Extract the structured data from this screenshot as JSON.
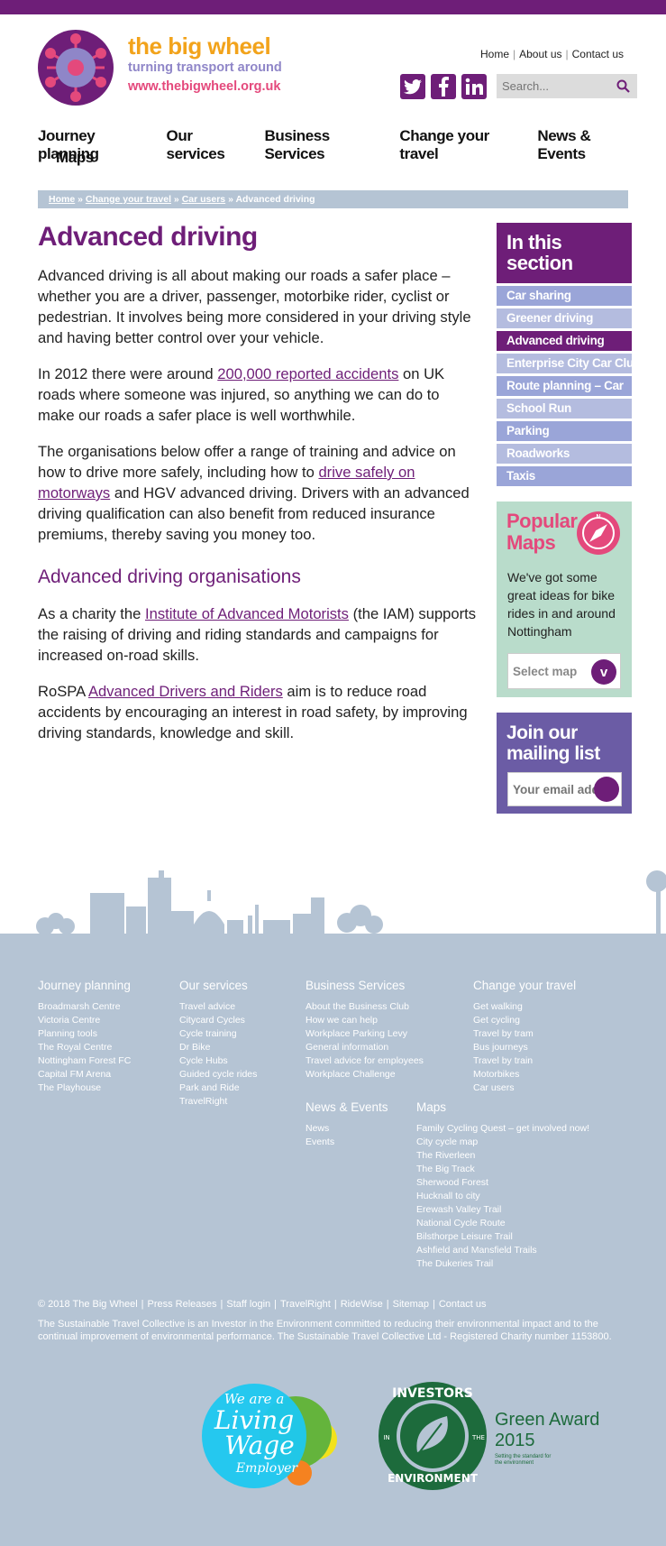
{
  "brand": {
    "name": "the big wheel",
    "tagline": "turning transport around",
    "url": "www.thebigwheel.org.uk",
    "colors": {
      "purple": "#6e1e78",
      "orange": "#f2a31b",
      "lavender": "#8f86c8",
      "pink": "#e4497c"
    }
  },
  "toplinks": [
    "Home",
    "About us",
    "Contact us"
  ],
  "social": {
    "icons": [
      "twitter-icon",
      "facebook-icon",
      "linkedin-icon"
    ]
  },
  "search": {
    "placeholder": "Search..."
  },
  "nav": {
    "items": [
      "Journey planning",
      "Our services",
      "Business Services",
      "Change your travel",
      "News & Events",
      "Maps"
    ]
  },
  "breadcrumb": {
    "items": [
      "Home",
      "Change your travel",
      "Car users"
    ],
    "current": "Advanced driving",
    "separator": "»"
  },
  "page": {
    "title": "Advanced driving",
    "p1": "Advanced driving is all about making our roads a safer place – whether you are a driver, passenger, motorbike rider, cyclist or pedestrian. It involves being more considered in your driving style and having better control over your vehicle.",
    "p2_before": "In 2012 there were around ",
    "p2_link": "200,000 reported accidents",
    "p2_after": " on UK roads where someone was injured, so anything we can do to make our roads a safer place is well worthwhile.",
    "p3_before": "The organisations below offer a range of training and advice on how to drive more safely, including how to ",
    "p3_link": "drive safely on motorways",
    "p3_after": " and HGV advanced driving.  Drivers with an advanced driving qualification can also benefit from reduced insurance premiums, thereby saving you money too.",
    "subheading": "Advanced driving organisations",
    "p4_before": "As a charity the ",
    "p4_link": "Institute of Advanced Motorists",
    "p4_after": " (the IAM) supports the raising of driving and riding standards and campaigns for increased on-road skills.",
    "p5_before": "RoSPA ",
    "p5_link": "Advanced Drivers and Riders",
    "p5_after": " aim is to reduce road accidents by encouraging an interest in road safety, by improving driving standards, knowledge and skill."
  },
  "section": {
    "title": "In this section",
    "items": [
      "Car sharing",
      "Greener driving",
      "Advanced driving",
      "Enterprise City Car Club",
      "Route planning – Car",
      "School Run",
      "Parking",
      "Roadworks",
      "Taxis"
    ],
    "active": "Advanced driving"
  },
  "popular_maps": {
    "title": "Popular Maps",
    "description": "We've got some great ideas for bike rides in and around Nottingham",
    "select_label": "Select map",
    "select_button": "v"
  },
  "mailing": {
    "title": "Join our mailing list",
    "placeholder": "Your email address"
  },
  "footer": {
    "columns": [
      {
        "title": "Journey planning",
        "links": [
          "Broadmarsh Centre",
          "Victoria Centre",
          "Planning tools",
          "The Royal Centre",
          "Nottingham Forest FC",
          "Capital FM Arena",
          "The Playhouse"
        ]
      },
      {
        "title": "Our services",
        "links": [
          "Travel advice",
          "Citycard Cycles",
          "Cycle training",
          "Dr Bike",
          "Cycle Hubs",
          "Guided cycle rides",
          "Park and Ride",
          "TravelRight"
        ]
      },
      {
        "title": "Business Services",
        "links": [
          "About the Business Club",
          "How we can help",
          "Workplace Parking Levy",
          "General information",
          "Travel advice for employees",
          "Workplace Challenge"
        ]
      },
      {
        "title": "Change your travel",
        "links": [
          "Get walking",
          "Get cycling",
          "Travel by tram",
          "Bus journeys",
          "Travel by train",
          "Motorbikes",
          "Car users"
        ]
      },
      {
        "title": "News & Events",
        "links": [
          "News",
          "Events"
        ]
      },
      {
        "title": "Maps",
        "links": [
          "Family Cycling Quest – get involved now!",
          "City cycle map",
          "The Riverleen",
          "The Big Track",
          "Sherwood Forest",
          "Hucknall to city",
          "Erewash Valley Trail",
          "National Cycle Route",
          "Bilsthorpe Leisure Trail",
          "Ashfield and Mansfield Trails",
          "The Dukeries Trail"
        ]
      }
    ],
    "bottom_links": [
      "© 2018 The Big Wheel",
      "Press Releases",
      "Staff login",
      "TravelRight",
      "RideWise",
      "Sitemap",
      "Contact us"
    ],
    "statement": "The Sustainable Travel Collective is an Investor in the Environment committed to reducing their environmental impact and to the continual improvement of environmental performance. The Sustainable Travel Collective Ltd - Registered Charity number 1153800.",
    "living_wage": {
      "line1": "We are a",
      "line2": "Living",
      "line3": "Wage",
      "line4": "Employer"
    },
    "iie": {
      "top": "INVESTORS",
      "in": "IN",
      "the": "THE",
      "bottom": "ENVIRONMENT",
      "award": "Green Award",
      "year": "2015",
      "sub1": "Setting the standard for",
      "sub2": "the environment"
    }
  }
}
